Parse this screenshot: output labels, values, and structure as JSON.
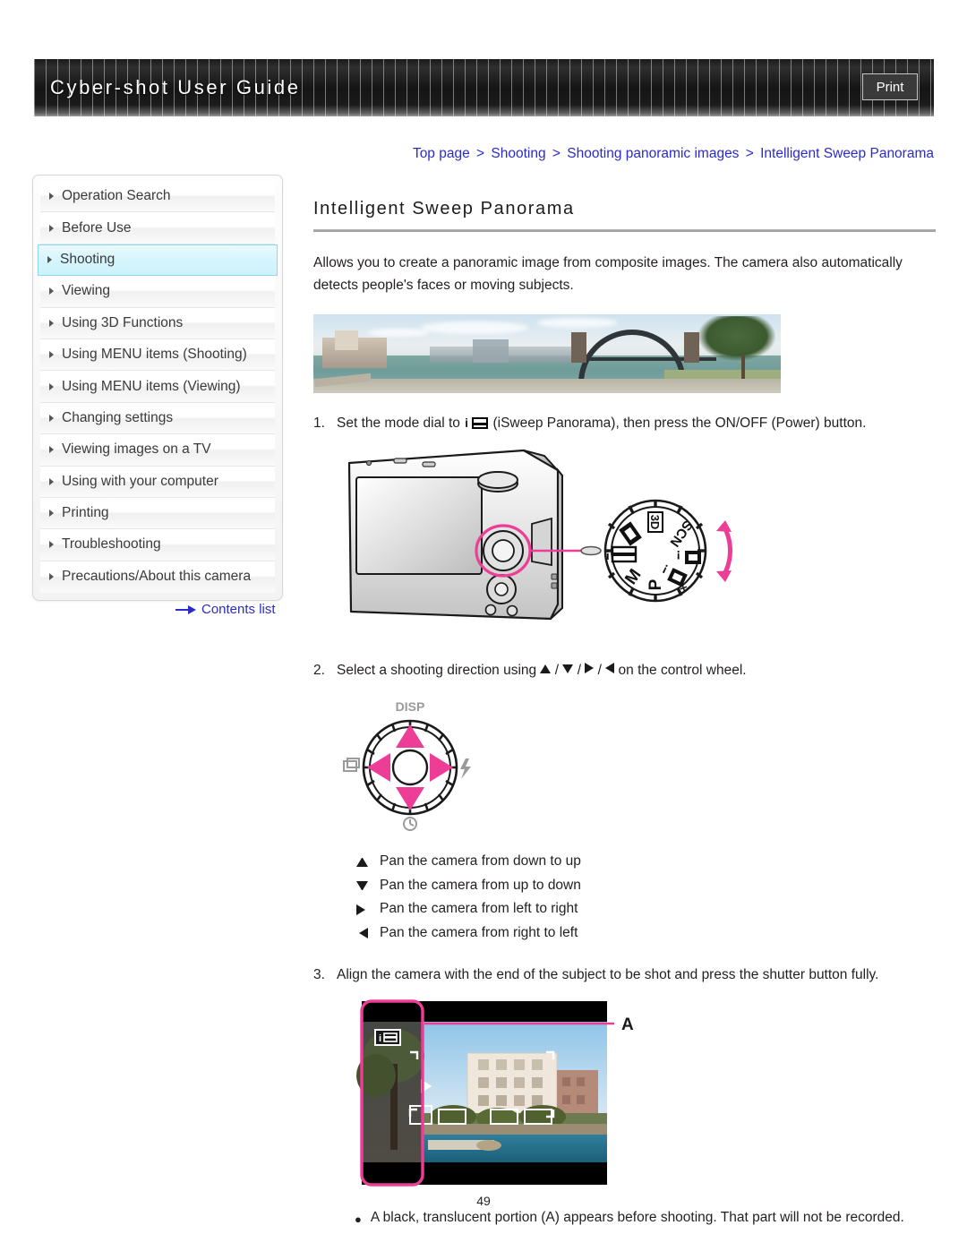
{
  "header": {
    "title": "Cyber-shot User Guide",
    "print_label": "Print"
  },
  "breadcrumb": {
    "items": [
      "Top page",
      "Shooting",
      "Shooting panoramic images",
      "Intelligent Sweep Panorama"
    ],
    "separator": ">"
  },
  "sidebar": {
    "items": [
      {
        "label": "Operation Search",
        "active": false
      },
      {
        "label": "Before Use",
        "active": false
      },
      {
        "label": "Shooting",
        "active": true
      },
      {
        "label": "Viewing",
        "active": false
      },
      {
        "label": "Using 3D Functions",
        "active": false
      },
      {
        "label": "Using MENU items (Shooting)",
        "active": false
      },
      {
        "label": "Using MENU items (Viewing)",
        "active": false
      },
      {
        "label": "Changing settings",
        "active": false
      },
      {
        "label": "Viewing images on a TV",
        "active": false
      },
      {
        "label": "Using with your computer",
        "active": false
      },
      {
        "label": "Printing",
        "active": false
      },
      {
        "label": "Troubleshooting",
        "active": false
      },
      {
        "label": "Precautions/About this camera",
        "active": false
      }
    ],
    "contents_list_label": "Contents list"
  },
  "main": {
    "heading": "Intelligent Sweep Panorama",
    "intro": "Allows you to create a panoramic image from composite images. The camera also automatically detects people's faces or moving subjects.",
    "steps": [
      {
        "number": "1.",
        "text_before_icon": "Set the mode dial to ",
        "icon_name": "isweep-panorama-icon",
        "text_after_icon": " (iSweep Panorama), then press the ON/OFF (Power) button."
      },
      {
        "number": "2.",
        "text_before": "Select a shooting direction using ",
        "text_after": " on the control wheel."
      },
      {
        "number": "3.",
        "text": "Align the camera with the end of the subject to be shot and press the shutter button fully."
      }
    ],
    "mode_dial": {
      "labels": [
        "3D",
        "SCN",
        "M",
        "P"
      ]
    },
    "control_wheel": {
      "top_label": "DISP",
      "right_icon": "flash-icon",
      "bottom_icon": "self-timer-icon",
      "left_icon": "burst-mode-icon"
    },
    "direction_legend": [
      {
        "glyph": "up",
        "text": "Pan the camera from down to up"
      },
      {
        "glyph": "down",
        "text": "Pan the camera from up to down"
      },
      {
        "glyph": "right",
        "text": "Pan the camera from left to right"
      },
      {
        "glyph": "left",
        "text": "Pan the camera from right to left"
      }
    ],
    "lcd_callout_label": "A",
    "note": {
      "bullet": "●",
      "text": "A black, translucent portion (A) appears before shooting. That part will not be recorded."
    }
  },
  "footer": {
    "page_number": "49"
  },
  "colors": {
    "link": "#2b2bc8",
    "accent_pink": "#ee3d96",
    "active_nav": "#cdf2fc",
    "header_dark": "#1a1a1a"
  }
}
